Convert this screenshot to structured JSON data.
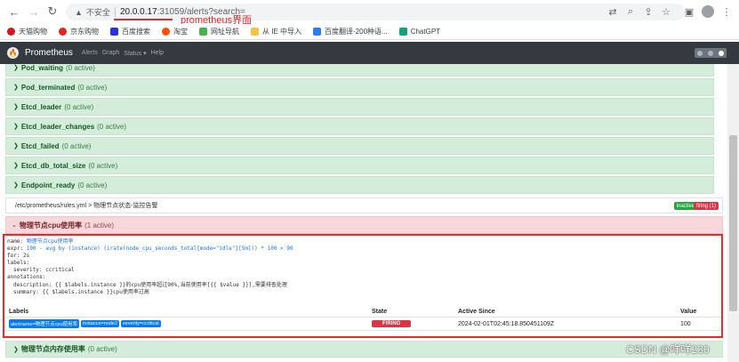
{
  "browser": {
    "insecure_label": "不安全",
    "url_host": "20.0.0.17",
    "url_path": ":31059/alerts?search=",
    "annotation": "prometheus界面"
  },
  "bookmarks": [
    {
      "label": "天猫购物",
      "color": "#d7141a"
    },
    {
      "label": "京东购物",
      "color": "#e1251b"
    },
    {
      "label": "百度搜索",
      "color": "#2932e1"
    },
    {
      "label": "淘宝",
      "color": "#ff5000"
    },
    {
      "label": "网址导航",
      "color": "#4caf50"
    },
    {
      "label": "从 IE 中导入",
      "color": "#f4c542"
    },
    {
      "label": "百度翻译-200种语...",
      "color": "#2b7cf6"
    },
    {
      "label": "ChatGPT",
      "color": "#10a37f"
    }
  ],
  "prom_nav": {
    "brand": "Prometheus",
    "links": [
      "Alerts",
      "Graph",
      "Status ▾",
      "Help"
    ]
  },
  "inactive_groups": [
    {
      "name": "Pod_waiting",
      "count": "(0 active)"
    },
    {
      "name": "Pod_terminated",
      "count": "(0 active)"
    },
    {
      "name": "Etcd_leader",
      "count": "(0 active)"
    },
    {
      "name": "Etcd_leader_changes",
      "count": "(0 active)"
    },
    {
      "name": "Etcd_failed",
      "count": "(0 active)"
    },
    {
      "name": "Etcd_db_total_size",
      "count": "(0 active)"
    },
    {
      "name": "Endpoint_ready",
      "count": "(0 active)"
    }
  ],
  "file_header": {
    "text": "/etc/prometheus/rules.yml > 物理节点状态-监控告警",
    "badge_inactive": "inactive",
    "badge_firing": "firing (1)"
  },
  "firing_rule": {
    "name": "物理节点cpu使用率",
    "count": "(1 active)",
    "yaml": {
      "name_key": "name:",
      "name_val": "物理节点cpu使用率",
      "expr_key": "expr:",
      "expr_val": "100 - avg by (instance) (irate(node_cpu_seconds_total{mode=\"idle\"}[5m])) * 100 > 90",
      "for_line": "for: 2s",
      "labels_key": "labels:",
      "severity_line": "severity: ccritical",
      "annotations_key": "annotations:",
      "description_line": "description: {{ $labels.instance }}的cpu使用率超过90%,当前使用率[{{ $value }}],需要排查处理",
      "summary_line": "summary: {{ $labels.instance }}cpu使用率过高"
    }
  },
  "alerts_table": {
    "headers": [
      "Labels",
      "State",
      "Active Since",
      "Value"
    ],
    "rows": [
      {
        "labels": [
          "alertname=物理节点cpu使用率",
          "instance=node2",
          "severity=ccritical"
        ],
        "state": "FIRING",
        "active_since": "2024-02-01T02:45:18.850451109Z",
        "value": "100"
      }
    ]
  },
  "second_rule": {
    "name": "物理节点内存使用率",
    "count": "(0 active)"
  },
  "watermark": "CSDN @咩咩230",
  "colors": {
    "inactive_bg": "#d4edda",
    "firing_bg": "#f8d7da",
    "navbar": "#343a40",
    "annotation_red": "#e8292d",
    "label_chip": "#007bff"
  }
}
